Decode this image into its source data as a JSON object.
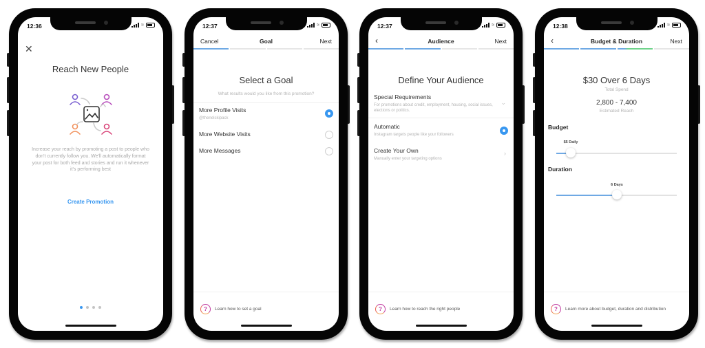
{
  "phones": [
    {
      "time": "12:36",
      "close_icon": "close-icon",
      "title": "Reach New People",
      "illustration": "reach-people-icon",
      "description": "Increase your reach by promoting a post to people who don't currently follow you. We'll automatically format your post for both feed and stories and run it whenever it's performing best",
      "cta": "Create Promotion",
      "page_dots": {
        "total": 4,
        "active": 1
      }
    },
    {
      "time": "12:37",
      "nav": {
        "left": "Cancel",
        "title": "Goal",
        "right": "Next"
      },
      "progress": {
        "total": 4,
        "completed": 1
      },
      "heading": "Select a Goal",
      "subheading": "What results would you like from this promotion?",
      "options": [
        {
          "label": "More Profile Visits",
          "sub": "@thenelskipack",
          "selected": true
        },
        {
          "label": "More Website Visits",
          "sub": "",
          "selected": false
        },
        {
          "label": "More Messages",
          "sub": "",
          "selected": false
        }
      ],
      "help": "Learn how to set a goal"
    },
    {
      "time": "12:37",
      "nav": {
        "left_icon": "back-chevron-icon",
        "title": "Audience",
        "right": "Next"
      },
      "progress": {
        "total": 4,
        "completed": 2
      },
      "heading": "Define Your Audience",
      "options": [
        {
          "label": "Special Requirements",
          "sub": "For promotions about credit, employment, housing, social issues, elections or politics.",
          "control": "chevron-down"
        },
        {
          "label": "Automatic",
          "sub": "Instagram targets people like your followers",
          "control": "radio",
          "selected": true
        },
        {
          "label": "Create Your Own",
          "sub": "Manually enter your targeting options",
          "control": "chevron-right"
        }
      ],
      "help": "Learn how to reach the right people"
    },
    {
      "time": "12:38",
      "nav": {
        "left_icon": "back-chevron-icon",
        "title": "Budget & Duration",
        "right": "Next"
      },
      "progress": {
        "total": 4,
        "completed": 3,
        "active_color": "#6fd38b"
      },
      "total_spend": "$30 Over 6 Days",
      "total_spend_label": "Total Spend",
      "reach": "2,800 - 7,400",
      "reach_label": "Estimated Reach",
      "budget": {
        "label": "Budget",
        "value_label": "$5 Daily",
        "fraction": 0.12
      },
      "duration": {
        "label": "Duration",
        "value_label": "6 Days",
        "fraction": 0.5
      },
      "help": "Learn more about budget, duration and distribution"
    }
  ],
  "colors": {
    "accent": "#3897f0",
    "progress": "#6fa9e4",
    "help_gradient": [
      "#c0399f",
      "#f19a4a"
    ]
  }
}
